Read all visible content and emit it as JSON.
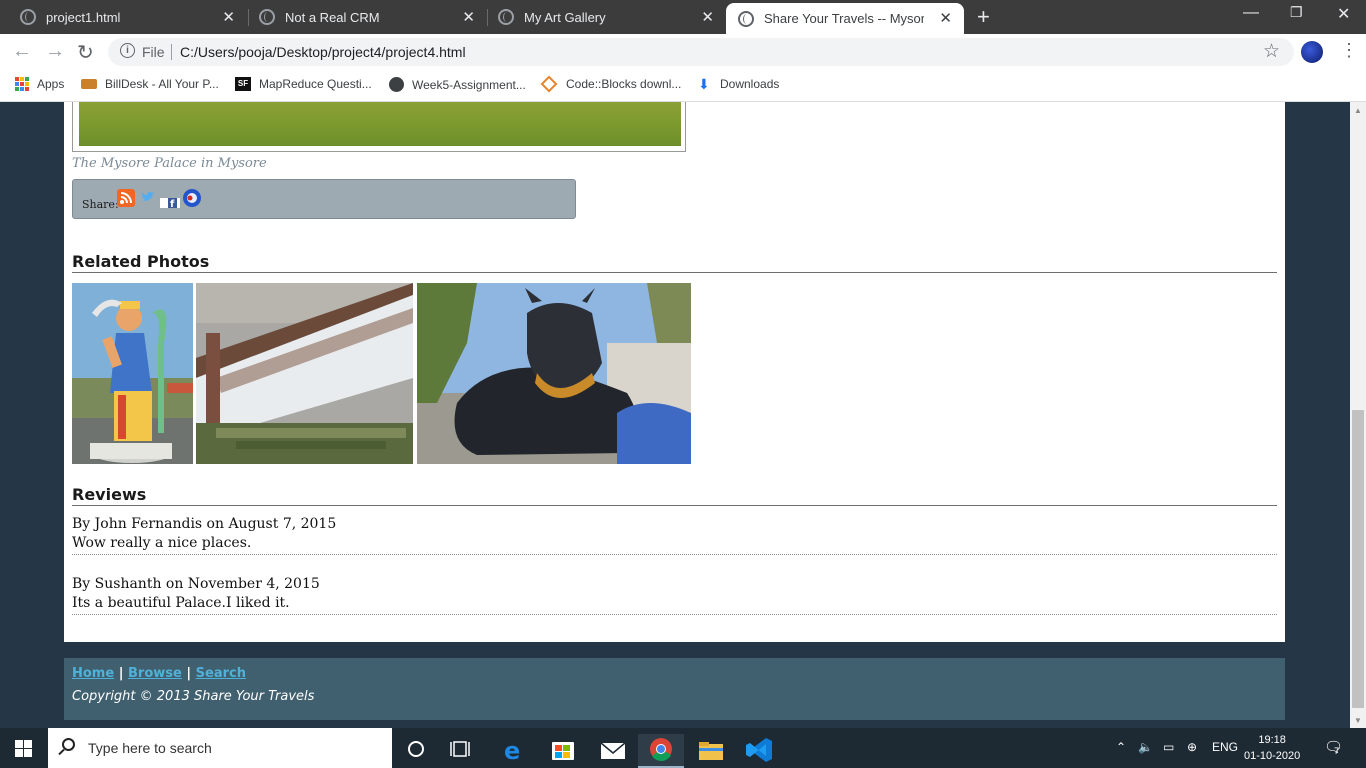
{
  "browser": {
    "tabs": [
      {
        "label": "project1.html"
      },
      {
        "label": "Not a Real CRM"
      },
      {
        "label": "My Art Gallery"
      },
      {
        "label": "Share Your Travels -- Mysore - Ch"
      }
    ],
    "address": {
      "scheme": "File",
      "url": "C:/Users/pooja/Desktop/project4/project4.html"
    },
    "bookmarks": [
      {
        "label": "Apps"
      },
      {
        "label": "BillDesk - All Your P..."
      },
      {
        "label": "MapReduce Questi..."
      },
      {
        "label": "Week5-Assignment..."
      },
      {
        "label": "Code::Blocks downl..."
      },
      {
        "label": "Downloads"
      }
    ],
    "bookmark_icons": {
      "mapreduce": "SF"
    }
  },
  "page": {
    "photo_caption": "The Mysore Palace in Mysore",
    "share_label": "Share:",
    "related_heading": "Related Photos",
    "related_photos": [
      {
        "name": "mahishasura-statue-photo"
      },
      {
        "name": "krs-dam-photo"
      },
      {
        "name": "nandi-bull-statue-photo"
      }
    ],
    "reviews_heading": "Reviews",
    "reviews": [
      {
        "byline": "By John Fernandis on August 7, 2015",
        "text": "Wow really a nice places."
      },
      {
        "byline": "By Sushanth on November 4, 2015",
        "text": "Its a beautiful Palace.I liked it."
      }
    ],
    "footer": {
      "links": [
        "Home",
        "Browse",
        "Search"
      ],
      "separator": "|",
      "copyright": "Copyright © 2013 Share Your Travels"
    },
    "colors": {
      "page_bg": "#253746",
      "footer_bg": "#40606f",
      "link": "#4fb1d9",
      "share_bg": "#9eaab2"
    }
  },
  "taskbar": {
    "search_placeholder": "Type here to search",
    "language": "ENG",
    "time": "19:18",
    "date": "01-10-2020",
    "notification_count": "7"
  }
}
